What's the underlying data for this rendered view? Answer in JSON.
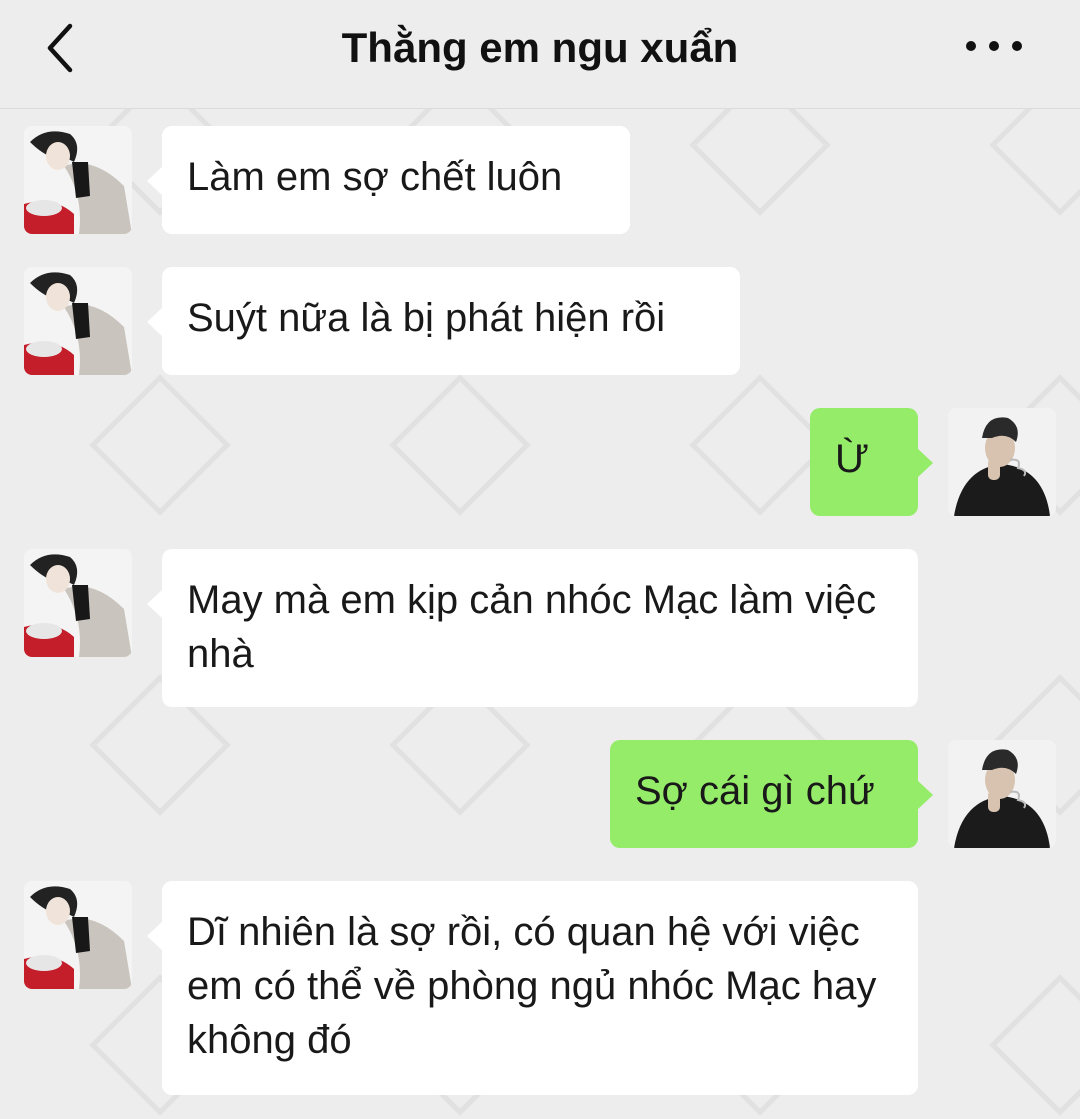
{
  "header": {
    "title": "Thằng em ngu xuẩn",
    "back_icon": "chevron-left-icon",
    "more_icon": "more-horizontal-icon"
  },
  "colors": {
    "background": "#ededed",
    "incoming_bubble": "#ffffff",
    "outgoing_bubble": "#95ec69"
  },
  "messages": [
    {
      "from": "other",
      "text": "Làm em sợ chết luôn"
    },
    {
      "from": "other",
      "text": "Suýt nữa là bị phát hiện rồi"
    },
    {
      "from": "me",
      "text": "Ừ"
    },
    {
      "from": "other",
      "text": "May mà em kịp cản nhóc Mạc làm việc nhà"
    },
    {
      "from": "me",
      "text": "Sợ cái gì chứ"
    },
    {
      "from": "other",
      "text": "Dĩ nhiên là sợ rồi, có quan hệ với việc em có thể về phòng ngủ nhóc Mạc hay không đó"
    }
  ]
}
